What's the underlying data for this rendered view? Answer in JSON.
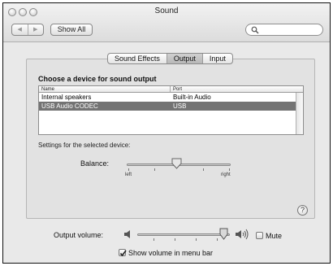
{
  "window": {
    "title": "Sound"
  },
  "toolbar": {
    "back_icon": "left-arrow-icon",
    "forward_icon": "right-arrow-icon",
    "show_all_label": "Show All",
    "search_placeholder": "",
    "search_icon": "magnifier-icon"
  },
  "tabs": [
    {
      "label": "Sound Effects",
      "active": false
    },
    {
      "label": "Output",
      "active": true
    },
    {
      "label": "Input",
      "active": false
    }
  ],
  "output": {
    "section_title": "Choose a device for sound output",
    "columns": [
      "Name",
      "Port"
    ],
    "devices": [
      {
        "name": "Internal speakers",
        "port": "Built-in Audio",
        "selected": false
      },
      {
        "name": "USB Audio CODEC",
        "port": "USB",
        "selected": true
      }
    ],
    "settings_label": "Settings for the selected device:",
    "balance_label": "Balance:",
    "balance_left_label": "left",
    "balance_right_label": "right",
    "balance_value": 0.5
  },
  "help_label": "?",
  "volume": {
    "label": "Output volume:",
    "value": 0.9,
    "low_icon": "speaker-low-icon",
    "high_icon": "speaker-high-icon",
    "mute_label": "Mute",
    "mute_checked": false,
    "menu_bar_label": "Show volume in menu bar",
    "menu_bar_checked": true
  },
  "colors": {
    "selected_row": "#737373",
    "window_bg": "#e9e9e9"
  }
}
